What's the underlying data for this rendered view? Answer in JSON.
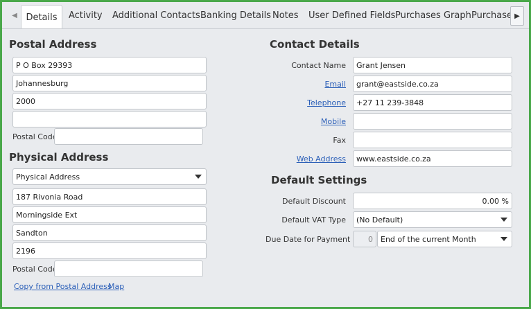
{
  "tabs": [
    {
      "label": "Details",
      "active": true
    },
    {
      "label": "Activity",
      "active": false
    },
    {
      "label": "Additional Contacts",
      "active": false
    },
    {
      "label": "Banking Details",
      "active": false
    },
    {
      "label": "Notes",
      "active": false
    },
    {
      "label": "User Defined Fields",
      "active": false
    },
    {
      "label": "Purchases Graph",
      "active": false
    },
    {
      "label": "Purchase C",
      "active": false
    }
  ],
  "scroll_icons": {
    "left": "triangle-left-icon",
    "right": "triangle-right-icon"
  },
  "postal": {
    "title": "Postal Address",
    "line1": "P O Box 29393",
    "line2": "Johannesburg",
    "line3": "2000",
    "line4": "",
    "postal_code_label": "Postal Code",
    "postal_code": ""
  },
  "physical": {
    "title": "Physical Address",
    "type_selected": "Physical Address",
    "line1": "187 Rivonia Road",
    "line2": "Morningside Ext",
    "line3": "Sandton",
    "line4": "2196",
    "postal_code_label": "Postal Code",
    "postal_code": "",
    "copy_link": "Copy from Postal Address",
    "map_link": "Map"
  },
  "contact": {
    "title": "Contact Details",
    "name_label": "Contact Name",
    "name": "Grant Jensen",
    "email_label": "Email",
    "email": "grant@eastside.co.za",
    "telephone_label": "Telephone",
    "telephone": "+27 11 239-3848",
    "mobile_label": "Mobile",
    "mobile": "",
    "fax_label": "Fax",
    "fax": "",
    "web_label": "Web Address",
    "web": "www.eastside.co.za"
  },
  "defaults": {
    "title": "Default Settings",
    "discount_label": "Default Discount",
    "discount": "0.00 %",
    "vat_label": "Default VAT Type",
    "vat": "(No Default)",
    "due_label": "Due Date for Payment",
    "due_days": "0",
    "due_option": "End of the current Month"
  },
  "colors": {
    "frame_border": "#4aa84a",
    "link": "#2b5fb8",
    "background": "#e9ebee"
  }
}
